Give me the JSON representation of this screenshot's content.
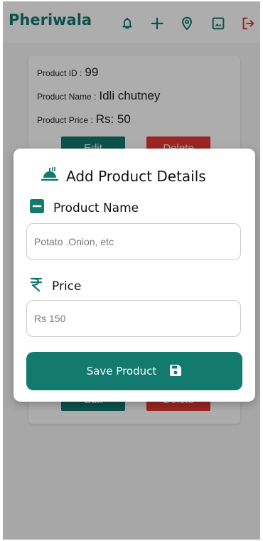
{
  "appbar": {
    "title": "Pheriwala",
    "icons": [
      "bell-icon",
      "plus-icon",
      "location-pin-icon",
      "image-icon",
      "logout-icon"
    ]
  },
  "product_card": {
    "id_label": "Product ID :",
    "id_value": "99",
    "name_label": "Product Name :",
    "name_value": "Idli chutney",
    "price_label": "Product Price :",
    "price_value": "Rs: 50",
    "edit_label": "Edit",
    "delete_label": "Delete"
  },
  "dialog": {
    "title": "Add Product Details",
    "name_label": "Product Name",
    "name_placeholder": "Potato .Onion, etc",
    "price_label": "Price",
    "price_placeholder": "Rs 150",
    "save_label": "Save Product"
  },
  "colors": {
    "primary": "#127a6f",
    "danger": "#e53935"
  }
}
